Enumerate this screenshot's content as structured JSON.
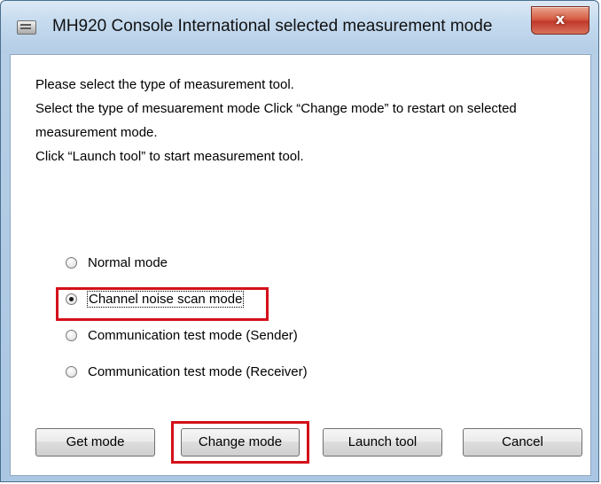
{
  "window": {
    "title": "MH920 Console International selected measurement mode",
    "close_glyph": "x",
    "icon": "app-window-icon"
  },
  "instructions": {
    "line1": "Please select the type of measurement tool.",
    "line2": "Select the type of mesuarement mode Click “Change mode” to restart on selected",
    "line3": "measurement mode.",
    "line4": "Click “Launch tool” to start  measurement tool."
  },
  "modes": {
    "selected": "Channel noise scan mode",
    "options": [
      "Normal mode",
      "Channel noise scan mode",
      "Communication test mode (Sender)",
      "Communication test mode (Receiver)"
    ]
  },
  "buttons": {
    "get_mode": "Get mode",
    "change_mode": "Change mode",
    "launch_tool": "Launch tool",
    "cancel": "Cancel"
  },
  "highlight_color": "#d4101a"
}
